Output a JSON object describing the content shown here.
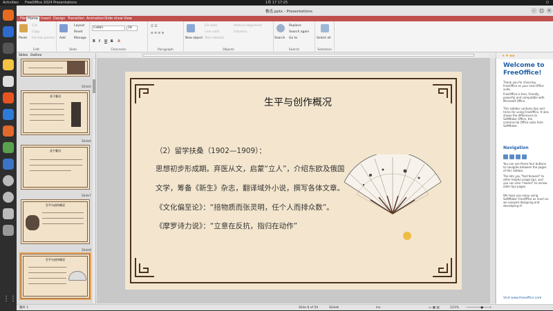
{
  "system": {
    "activities": "Activities",
    "app_name": "FreeOffice 2024 Presentations",
    "clock": "1月 17  17:25"
  },
  "window": {
    "title": "鲁迅.pptx - Presentations"
  },
  "menu_tabs": [
    "File",
    "Home",
    "Insert",
    "Design",
    "Transition",
    "Animation",
    "Slide show",
    "View"
  ],
  "ribbon": {
    "edit": {
      "paste": "Paste",
      "cut": "Cut",
      "copy": "Copy",
      "format_painter": "Format painter",
      "label": "Edit"
    },
    "slide": {
      "add": "Add",
      "layout": "Layout",
      "reset": "Reset",
      "manage": "Manage",
      "label": "Slide"
    },
    "character": {
      "font": "Calibri",
      "size": "18",
      "label": "Character"
    },
    "paragraph": {
      "label": "Paragraph"
    },
    "objects": {
      "fill_color": "Fill color",
      "line_color": "Line color",
      "text_rotation": "Text rotation",
      "vertical_alignment": "Vertical alignment",
      "columns": "Columns",
      "new_object": "New object",
      "label": "Objects"
    },
    "search": {
      "search": "Search",
      "replace": "Replace",
      "search_again": "Search again",
      "goto": "Go to",
      "label": "Search"
    },
    "selection": {
      "select_all": "Select all",
      "label": "Selection"
    }
  },
  "side_panel": {
    "tabs": [
      "Slides",
      "Outline"
    ],
    "slide_labels": [
      "Slide5",
      "Slide6",
      "Slide7",
      "Slide8"
    ],
    "thumbs": [
      {
        "title": "关于鲁迅"
      },
      {
        "title": "关于鲁迅"
      },
      {
        "title": "生平与创作概况"
      },
      {
        "title": "生平与创作概况"
      }
    ]
  },
  "slide": {
    "title": "生平与创作概况",
    "lines": [
      "（2）留学扶桑（1902—1909）：",
      "思想初步形成期。弃医从文，启蒙“立人”，介绍东欧及俄国",
      "文学，筹备《新生》杂志，翻译域外小说，撰写各体文章。",
      "《文化偏至论》：“掊物质而张灵明，任个人而排众数”。",
      "《摩罗诗力说》：“立意在反抗，指归在动作”"
    ]
  },
  "right_panel": {
    "welcome_title": "Welcome to FreeOffice!",
    "welcome_text": "Thank you for choosing FreeOffice as your new Office suite.",
    "text2": "FreeOffice is free, friendly, powerful and compatible with Microsoft Office.",
    "text3": "This sidebar contains tips and tricks for using FreeOffice. It also shows the differences to SoftMaker Office, the commercial Office suite from SoftMaker.",
    "nav_title": "Navigation",
    "nav_text": "You can use these four buttons to navigate between the pages of this sidebar.",
    "nav_text2": "The lets you \"fast-forward\" to other helpful usage tips, and you can also \"rewind\" to review older tips pages.",
    "nav_text3": "We hope you enjoy using SoftMaker FreeOffice as much as we enjoyed designing and developing it!",
    "link": "Visit www.freeoffice.com"
  },
  "status": {
    "left": "图片 1",
    "slide_of": "Slide 8 of 50",
    "slide_name": "Slide8",
    "ins": "Ins",
    "zoom": "121%"
  },
  "colors": {
    "accent": "#c0504d",
    "slide_bg": "#f4e6ce",
    "frame": "#4a3020"
  }
}
